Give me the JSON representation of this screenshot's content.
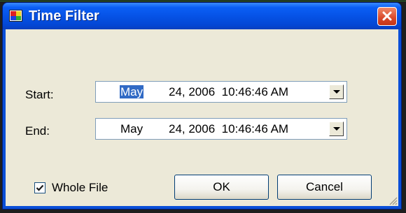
{
  "window": {
    "title": "Time Filter"
  },
  "start": {
    "label": "Start:",
    "month": "May",
    "rest": "24, 2006  10:46:46 AM"
  },
  "end": {
    "label": "End:",
    "month": "May",
    "rest": "24, 2006  10:46:46 AM"
  },
  "whole_file": {
    "label": "Whole File",
    "checked": true
  },
  "buttons": {
    "ok": "OK",
    "cancel": "Cancel"
  },
  "colors": {
    "titlebar": "#0653e6",
    "client": "#ece9d8",
    "selection": "#316ac5",
    "close": "#d8482a"
  }
}
